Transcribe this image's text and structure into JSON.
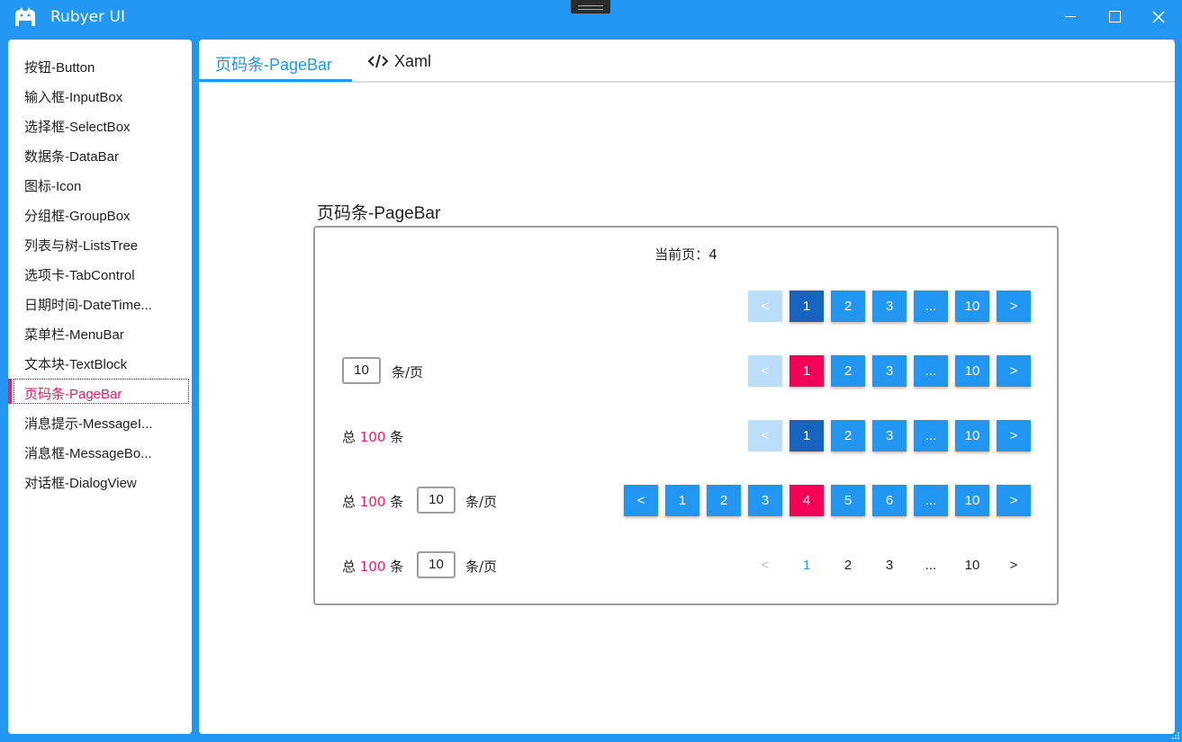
{
  "window": {
    "title": "Rubyer UI"
  },
  "sidebar": {
    "items": [
      {
        "label": "按钮-Button"
      },
      {
        "label": "输入框-InputBox"
      },
      {
        "label": "选择框-SelectBox"
      },
      {
        "label": "数据条-DataBar"
      },
      {
        "label": "图标-Icon"
      },
      {
        "label": "分组框-GroupBox"
      },
      {
        "label": "列表与树-ListsTree"
      },
      {
        "label": "选项卡-TabControl"
      },
      {
        "label": "日期时间-DateTime..."
      },
      {
        "label": "菜单栏-MenuBar"
      },
      {
        "label": "文本块-TextBlock"
      },
      {
        "label": "页码条-PageBar"
      },
      {
        "label": "消息提示-MessageI..."
      },
      {
        "label": "消息框-MessageBo..."
      },
      {
        "label": "对话框-DialogView"
      }
    ],
    "active_index": 11
  },
  "tabs": {
    "page_label": "页码条-PageBar",
    "xaml_label": "Xaml"
  },
  "group": {
    "title": "页码条-PageBar",
    "current_page_text": "当前页：4"
  },
  "pagebar": {
    "prev": "<",
    "next": ">",
    "ellipsis": "...",
    "last": "10",
    "page_size_value": "10",
    "per_page_label": "条/页",
    "total_prefix": "总",
    "total_value": "100",
    "total_suffix": "条",
    "pages": [
      "1",
      "2",
      "3",
      "4",
      "5",
      "6"
    ]
  },
  "colors": {
    "primary": "#2196F3",
    "dark_primary": "#1565C0",
    "accent": "#F50057",
    "active_nav": "#E91E63",
    "disabled": "#BBDEFB"
  }
}
